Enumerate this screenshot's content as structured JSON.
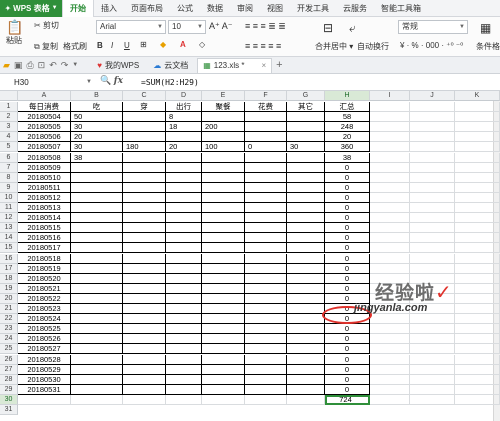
{
  "app": {
    "name": "WPS 表格"
  },
  "menu": [
    "开始",
    "插入",
    "页面布局",
    "公式",
    "数据",
    "审阅",
    "视图",
    "开发工具",
    "云服务",
    "智能工具箱"
  ],
  "ribbon": {
    "cut": "剪切",
    "paste": "粘贴",
    "copy": "复制",
    "format_painter": "格式刷",
    "font_name": "Arial",
    "font_size": "10",
    "merge_center": "合并居中",
    "wrap_text": "自动换行",
    "number_format": "常规",
    "conditional_format": "条件格",
    "bold": "B",
    "italic": "I",
    "underline": "U"
  },
  "tabs": [
    {
      "label": "我的WPS"
    },
    {
      "label": "云文档"
    },
    {
      "label": "123.xls *"
    }
  ],
  "formula_bar": {
    "cell_ref": "H30",
    "fx": "fx",
    "formula": "=SUM(H2:H29)"
  },
  "columns": [
    "A",
    "B",
    "C",
    "D",
    "E",
    "F",
    "G",
    "H",
    "I",
    "J",
    "K"
  ],
  "table": {
    "headers": [
      "每日消费",
      "吃",
      "穿",
      "出行",
      "聚餐",
      "花费",
      "其它",
      "汇总"
    ],
    "rows": [
      [
        "20180504",
        "50",
        "",
        "8",
        "",
        "",
        "",
        "58"
      ],
      [
        "20180505",
        "30",
        "",
        "18",
        "200",
        "",
        "",
        "248"
      ],
      [
        "20180506",
        "20",
        "",
        "",
        "",
        "",
        "",
        "20"
      ],
      [
        "20180507",
        "30",
        "180",
        "20",
        "100",
        "0",
        "30",
        "360"
      ],
      [
        "20180508",
        "38",
        "",
        "",
        "",
        "",
        "",
        "38"
      ],
      [
        "20180509",
        "",
        "",
        "",
        "",
        "",
        "",
        "0"
      ],
      [
        "20180510",
        "",
        "",
        "",
        "",
        "",
        "",
        "0"
      ],
      [
        "20180511",
        "",
        "",
        "",
        "",
        "",
        "",
        "0"
      ],
      [
        "20180512",
        "",
        "",
        "",
        "",
        "",
        "",
        "0"
      ],
      [
        "20180513",
        "",
        "",
        "",
        "",
        "",
        "",
        "0"
      ],
      [
        "20180514",
        "",
        "",
        "",
        "",
        "",
        "",
        "0"
      ],
      [
        "20180515",
        "",
        "",
        "",
        "",
        "",
        "",
        "0"
      ],
      [
        "20180516",
        "",
        "",
        "",
        "",
        "",
        "",
        "0"
      ],
      [
        "20180517",
        "",
        "",
        "",
        "",
        "",
        "",
        "0"
      ],
      [
        "20180518",
        "",
        "",
        "",
        "",
        "",
        "",
        "0"
      ],
      [
        "20180519",
        "",
        "",
        "",
        "",
        "",
        "",
        "0"
      ],
      [
        "20180520",
        "",
        "",
        "",
        "",
        "",
        "",
        "0"
      ],
      [
        "20180521",
        "",
        "",
        "",
        "",
        "",
        "",
        "0"
      ],
      [
        "20180522",
        "",
        "",
        "",
        "",
        "",
        "",
        "0"
      ],
      [
        "20180523",
        "",
        "",
        "",
        "",
        "",
        "",
        "0"
      ],
      [
        "20180524",
        "",
        "",
        "",
        "",
        "",
        "",
        "0"
      ],
      [
        "20180525",
        "",
        "",
        "",
        "",
        "",
        "",
        "0"
      ],
      [
        "20180526",
        "",
        "",
        "",
        "",
        "",
        "",
        "0"
      ],
      [
        "20180527",
        "",
        "",
        "",
        "",
        "",
        "",
        "0"
      ],
      [
        "20180528",
        "",
        "",
        "",
        "",
        "",
        "",
        "0"
      ],
      [
        "20180529",
        "",
        "",
        "",
        "",
        "",
        "",
        "0"
      ],
      [
        "20180530",
        "",
        "",
        "",
        "",
        "",
        "",
        "0"
      ],
      [
        "20180531",
        "",
        "",
        "",
        "",
        "",
        "",
        "0"
      ],
      [
        "",
        "",
        "",
        "",
        "",
        "",
        "",
        "724"
      ]
    ]
  },
  "watermark": {
    "text": "经验啦",
    "url": "jingyanla.com"
  },
  "colors": {
    "accent": "#2f8f3a",
    "highlight_circle": "#e0322c"
  }
}
